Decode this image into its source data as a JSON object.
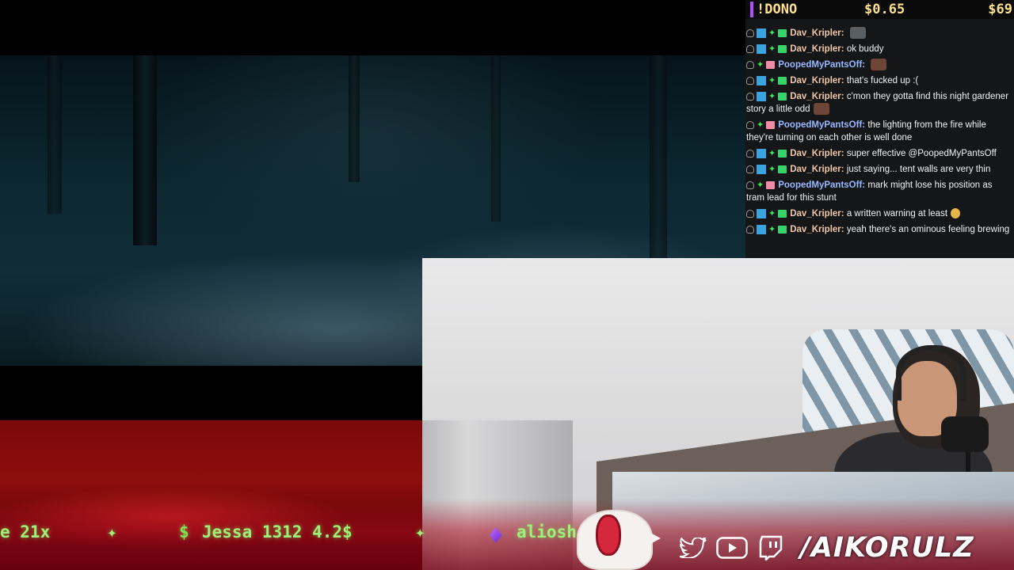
{
  "donation_bar": {
    "command": "!DONO",
    "amount": "$0.65",
    "total": "$69"
  },
  "chat": {
    "messages": [
      {
        "user": "Dav_Kripler",
        "text": "",
        "emote": true,
        "emote_style": "grey"
      },
      {
        "user": "Dav_Kripler",
        "text": "ok buddy"
      },
      {
        "user": "PoopedMyPantsOff",
        "text": "",
        "emote": true,
        "emote_style": "brown"
      },
      {
        "user": "Dav_Kripler",
        "text": "that's fucked up :("
      },
      {
        "user": "Dav_Kripler",
        "text": "c'mon they gotta find this night gardener story a little odd",
        "emote": true,
        "emote_style": "brown"
      },
      {
        "user": "PoopedMyPantsOff",
        "text": "the lighting from the fire while they're turning on each other is well done"
      },
      {
        "user": "Dav_Kripler",
        "text": "super effective @PoopedMyPantsOff"
      },
      {
        "user": "Dav_Kripler",
        "text": "just saying... tent walls are very thin"
      },
      {
        "user": "PoopedMyPantsOff",
        "text": "mark might lose his position as tram lead for this stunt"
      },
      {
        "user": "Dav_Kripler",
        "text": "a written warning at least",
        "emote": true,
        "emote_style": "yellow"
      },
      {
        "user": "Dav_Kripler",
        "text": "yeah there's an ominous feeling brewing"
      }
    ]
  },
  "ticker": {
    "item1": "e 21x",
    "sparkle": "✦",
    "currency_icon": "$",
    "item2": "Jessa 1312 4.2$",
    "item3": "aliosh"
  },
  "socials": {
    "icons": [
      "twitter-icon",
      "youtube-icon",
      "twitch-icon"
    ],
    "handle": "/AIKORULZ"
  },
  "colors": {
    "ticker_green": "#9ff07a",
    "donation_yellow": "#ffe08a",
    "accent_purple": "#b14cff",
    "dav_name": "#f0c8a8",
    "pooped_name": "#9ab7ff"
  }
}
